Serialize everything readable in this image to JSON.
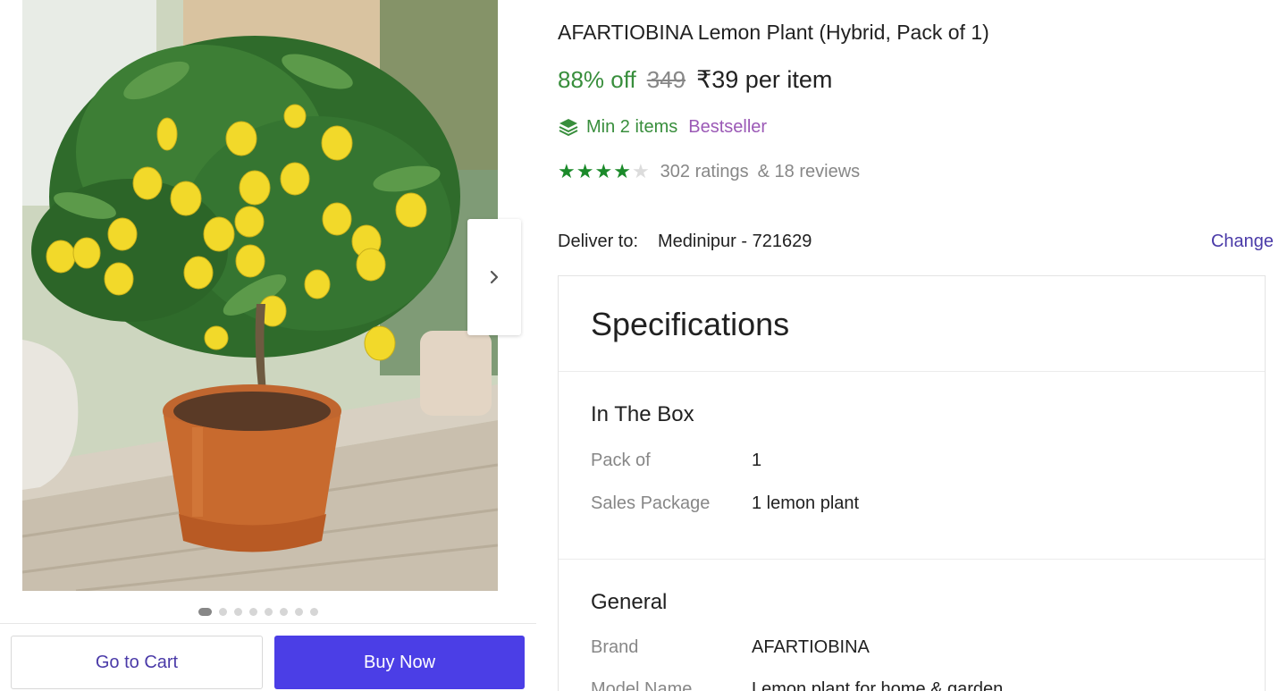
{
  "product": {
    "title": "AFARTIOBINA Lemon Plant (Hybrid, Pack of 1)",
    "discount": "88% off",
    "mrp": "349",
    "price": "₹39 per item",
    "min_items": "Min 2 items",
    "bestseller": "Bestseller",
    "rating": 4,
    "rating_max": 5,
    "ratings_text": "302 ratings",
    "reviews_text": "& 18 reviews"
  },
  "gallery": {
    "image_count": 8,
    "active_index": 0,
    "next_icon": "chevron-right-icon"
  },
  "delivery": {
    "label": "Deliver to:",
    "location": "Medinipur - 721629",
    "change_label": "Change"
  },
  "actions": {
    "cart_label": "Go to Cart",
    "buy_label": "Buy Now"
  },
  "specifications": {
    "title": "Specifications",
    "groups": [
      {
        "name": "In The Box",
        "rows": [
          {
            "key": "Pack of",
            "value": "1"
          },
          {
            "key": "Sales Package",
            "value": "1 lemon plant"
          }
        ]
      },
      {
        "name": "General",
        "rows": [
          {
            "key": "Brand",
            "value": "AFARTIOBINA"
          },
          {
            "key": "Model Name",
            "value": "Lemon plant for home & garden"
          }
        ]
      }
    ]
  },
  "colors": {
    "discount_green": "#388e3c",
    "buy_button": "#4b3ee6",
    "link_purple": "#4a3aa8",
    "bestseller_purple": "#9b59b6",
    "star_green": "#1b8a2a"
  }
}
